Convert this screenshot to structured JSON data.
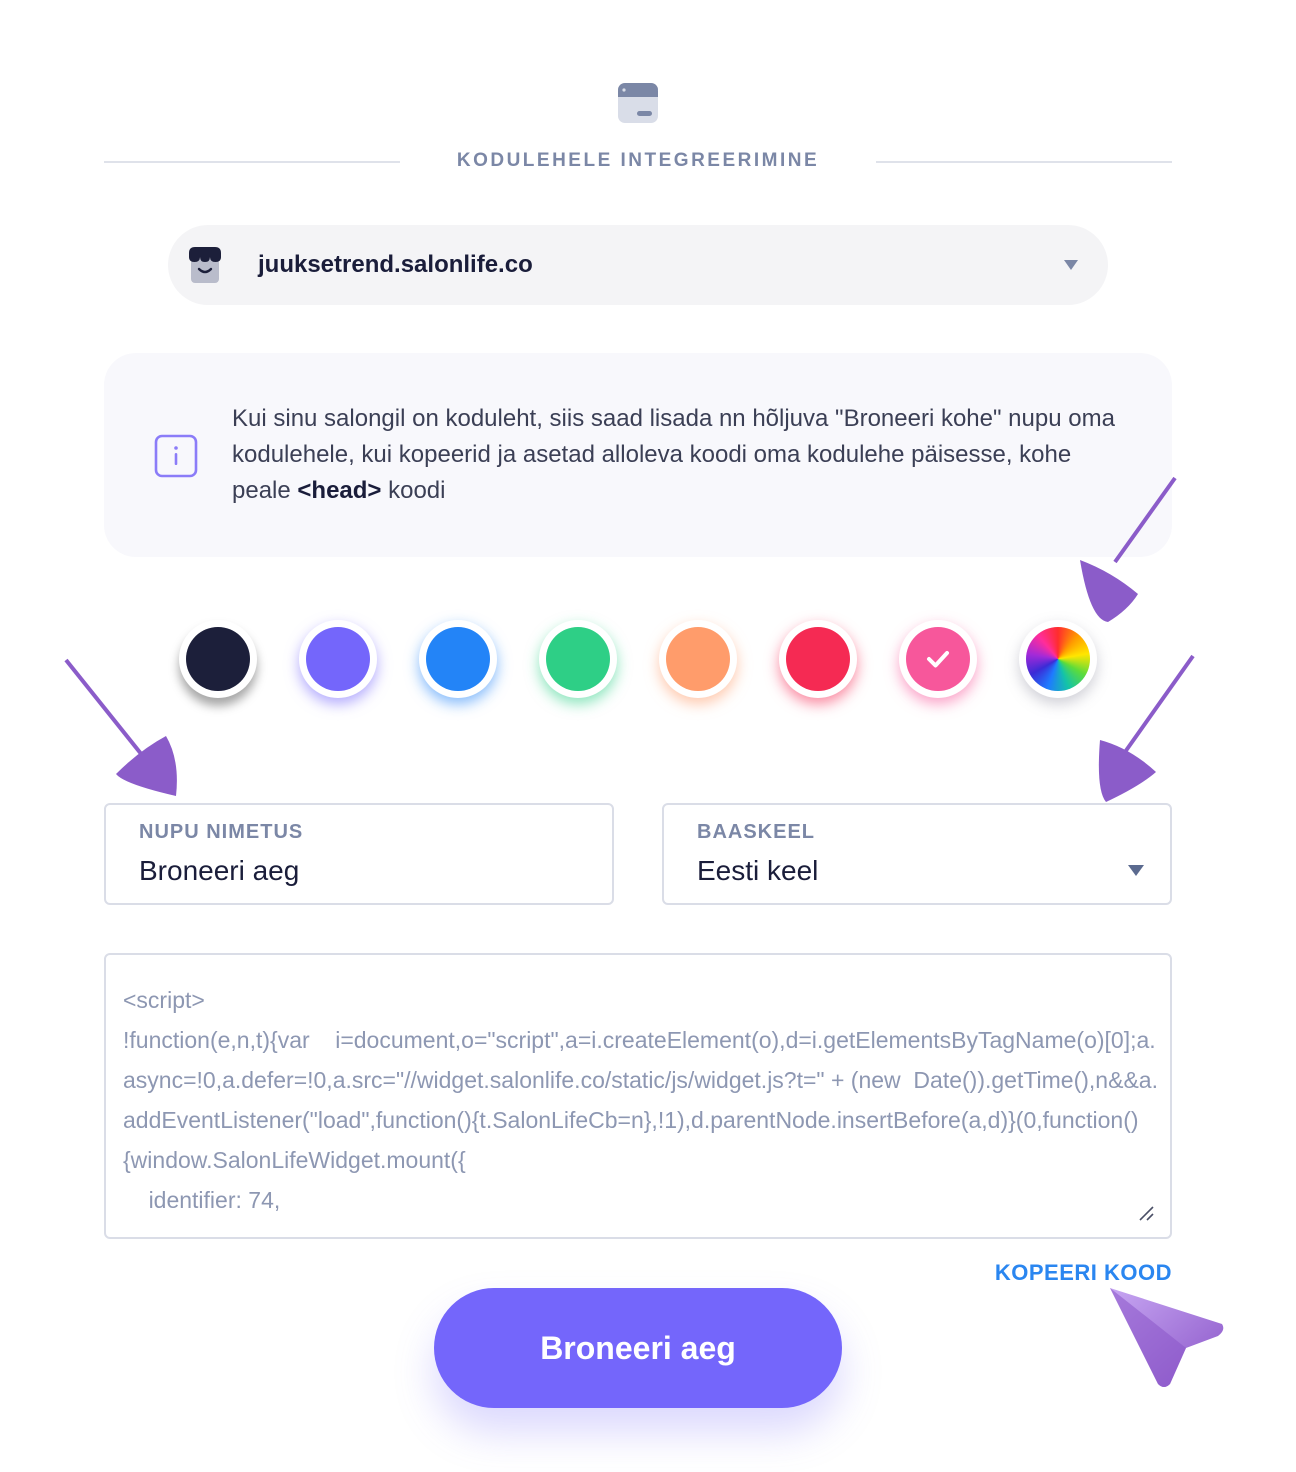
{
  "header": {
    "icon": "browser-window-icon",
    "title": "KODULEHELE INTEGREERIMINE"
  },
  "salon_select": {
    "avatar_icon": "shop-avatar-icon",
    "value": "juuksetrend.salonlife.co"
  },
  "info": {
    "icon": "info-icon",
    "text_before": "Kui sinu salongil on koduleht, siis saad lisada nn hõljuva \"Broneeri kohe\" nupu oma kodulehele, kui kopeerid ja asetad alloleva koodi oma kodulehe päisesse, kohe peale ",
    "text_bold": "<head>",
    "text_after": " koodi"
  },
  "colors": {
    "selected_index": 6,
    "options": [
      {
        "name": "color-navy",
        "hex": "#1c1f3a"
      },
      {
        "name": "color-purple",
        "hex": "#7466fb"
      },
      {
        "name": "color-blue",
        "hex": "#2384f7"
      },
      {
        "name": "color-green",
        "hex": "#2ecf86"
      },
      {
        "name": "color-orange",
        "hex": "#ff9c6b"
      },
      {
        "name": "color-red",
        "hex": "#f52a53"
      },
      {
        "name": "color-pink",
        "hex": "#f7579b"
      },
      {
        "name": "color-custom-wheel",
        "hex": "rainbow"
      }
    ]
  },
  "button_name_field": {
    "label": "NUPU NIMETUS",
    "value": "Broneeri aeg"
  },
  "language_field": {
    "label": "BAASKEEL",
    "value": "Eesti keel"
  },
  "code": {
    "text": "<script>\n!function(e,n,t){var    i=document,o=\"script\",a=i.createElement(o),d=i.getElementsByTagName(o)[0];a.async=!0,a.defer=!0,a.src=\"//widget.salonlife.co/static/js/widget.js?t=\" + (new  Date()).getTime(),n&&a.addEventListener(\"load\",function(){t.SalonLifeCb=n},!1),d.parentNode.insertBefore(a,d)}(0,function(){window.SalonLifeWidget.mount({\n    identifier: 74,"
  },
  "copy_link": "KOPEERI KOOD",
  "preview_button": {
    "label": "Broneeri aeg",
    "color": "#7466fb"
  },
  "annotation_color": "#8b5cc9"
}
